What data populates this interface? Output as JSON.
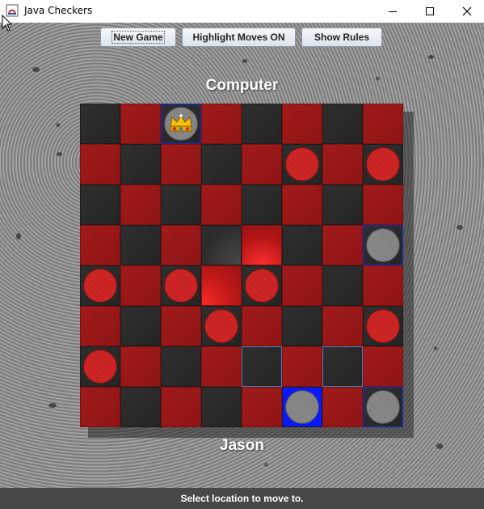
{
  "window": {
    "title": "Java Checkers"
  },
  "toolbar": {
    "new_game": "New Game",
    "highlight_moves": "Highlight Moves ON",
    "show_rules": "Show Rules"
  },
  "players": {
    "top": "Computer",
    "bottom": "Jason"
  },
  "status": {
    "text": "Select location to move to."
  },
  "colors": {
    "red_square": "#9a1717",
    "dark_square": "#2a2a2a",
    "red_piece": "#c82323",
    "gray_piece": "#858585",
    "selected_square": "#0a18ff",
    "hint_outline": "#4a7fc0"
  },
  "board": {
    "size": 8,
    "pieces": [
      {
        "row": 0,
        "col": 2,
        "color": "gray",
        "king": true
      },
      {
        "row": 1,
        "col": 5,
        "color": "red",
        "king": false
      },
      {
        "row": 1,
        "col": 7,
        "color": "red",
        "king": false
      },
      {
        "row": 3,
        "col": 7,
        "color": "gray",
        "king": false
      },
      {
        "row": 4,
        "col": 0,
        "color": "red",
        "king": false
      },
      {
        "row": 4,
        "col": 2,
        "color": "red",
        "king": false
      },
      {
        "row": 4,
        "col": 4,
        "color": "red",
        "king": false
      },
      {
        "row": 5,
        "col": 3,
        "color": "red",
        "king": false
      },
      {
        "row": 5,
        "col": 7,
        "color": "red",
        "king": false
      },
      {
        "row": 6,
        "col": 0,
        "color": "red",
        "king": false
      },
      {
        "row": 7,
        "col": 5,
        "color": "gray",
        "king": false
      },
      {
        "row": 7,
        "col": 7,
        "color": "gray",
        "king": false
      }
    ],
    "selected": {
      "row": 7,
      "col": 5
    },
    "move_hints": [
      {
        "row": 6,
        "col": 4
      },
      {
        "row": 6,
        "col": 6
      }
    ],
    "outlined_pieces": [
      {
        "row": 0,
        "col": 2
      },
      {
        "row": 3,
        "col": 7
      },
      {
        "row": 7,
        "col": 7
      }
    ],
    "glow_cells": [
      {
        "row": 3,
        "col": 3,
        "kind": "dark"
      },
      {
        "row": 3,
        "col": 4,
        "kind": "red2"
      },
      {
        "row": 4,
        "col": 3,
        "kind": "red"
      }
    ]
  }
}
